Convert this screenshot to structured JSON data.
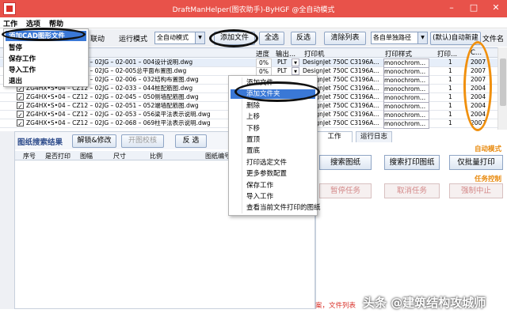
{
  "window": {
    "title": "DraftManHelper(图农助手)-ByHGF @全自动模式",
    "minimize": "–",
    "maximize": "□",
    "close": "✕"
  },
  "menubar": {
    "items": [
      "工作",
      "选项",
      "帮助"
    ]
  },
  "work_menu": {
    "items": [
      "添加CAD图形文件",
      "暂停",
      "保存工作",
      "导入工作",
      "退出"
    ],
    "highlighted_index": 0
  },
  "toolbar": {
    "linked_label": "联动",
    "run_mode_label": "运行模式",
    "run_mode_value": "全自动模式",
    "add_file": "添加文件",
    "select_all": "全选",
    "invert": "反选",
    "clear_list": "清除列表",
    "path_combo": "各自单独路径",
    "default_auto_new": "(默认)自动新建",
    "file_name_label": "文件名"
  },
  "grid": {
    "columns": [
      "进度",
      "输出...",
      "打印机",
      "打印样式",
      "打印...",
      "",
      "C..."
    ],
    "rows": [
      {
        "name": "ZG4HX•S•04 – CZ12 – 02JG – 02-001 – 004设计说明.dwg",
        "checked": true,
        "pct": "0%",
        "out": "PLT",
        "printer": "DesignJet  750C  C3196A...",
        "style": "monochrom...",
        "copies": "1",
        "year": "2007",
        "selected": true
      },
      {
        "name": "ZG4HX•S•04 – CZ12 – 02JG – 02-005总平面布置图.dwg",
        "checked": true,
        "pct": "0%",
        "out": "PLT",
        "printer": "DesignJet  750C  C3196A...",
        "style": "monochrom...",
        "copies": "1",
        "year": "2007",
        "selected": false
      },
      {
        "name": "ZG4HX•S•04 – CZ12 – 02JG – 02-006 – 032结构布置图.dwg",
        "checked": true,
        "pct": "0%",
        "out": "PLT",
        "printer": "DesignJet  750C  C3196A...",
        "style": "monochrom...",
        "copies": "1",
        "year": "2007",
        "selected": false
      },
      {
        "name": "ZG4HX•S•04 – CZ12 – 02JG – 02-033 – 044桩配筋图.dwg",
        "checked": true,
        "pct": "0%",
        "out": "PLT",
        "printer": "DesignJet  750C  C3196A...",
        "style": "monochrom...",
        "copies": "1",
        "year": "2004",
        "selected": false
      },
      {
        "name": "ZG4HX•S•04 – CZ12 – 02JG – 02-045 – 050侧墙配筋图.dwg",
        "checked": true,
        "pct": "0%",
        "out": "PLT",
        "printer": "DesignJet  750C  C3196A...",
        "style": "monochrom...",
        "copies": "1",
        "year": "2004",
        "selected": false
      },
      {
        "name": "ZG4HX•S•04 – CZ12 – 02JG – 02-051 – 052端墙配筋图.dwg",
        "checked": true,
        "pct": "0%",
        "out": "PLT",
        "printer": "DesignJet  750C  C3196A...",
        "style": "monochrom...",
        "copies": "1",
        "year": "2004",
        "selected": false
      },
      {
        "name": "ZG4HX•S•04 – CZ12 – 02JG – 02-053 – 056梁平法表示说明.dwg",
        "checked": true,
        "pct": "0%",
        "out": "PLT",
        "printer": "DesignJet  750C  C3196A...",
        "style": "monochrom...",
        "copies": "1",
        "year": "2004",
        "selected": false
      },
      {
        "name": "ZG4HX•S•04 – CZ12 – 02JG – 02-068 – 069柱平法表示说明.dwg",
        "checked": true,
        "pct": "0%",
        "out": "PLT",
        "printer": "DesignJet  750C  C3196A...",
        "style": "monochrom...",
        "copies": "1",
        "year": "2007",
        "selected": false
      }
    ]
  },
  "context_menu": {
    "items": [
      "添加文件",
      "添加文件夹",
      "删除",
      "上移",
      "下移",
      "置顶",
      "置底",
      "打印选定文件",
      "更多参数配置",
      "保存工作",
      "导入工作",
      "查看当前文件打印的图纸"
    ],
    "highlighted_index": 1
  },
  "search_panel": {
    "title": "图纸搜索结果",
    "unlock_edit": "解锁&修改",
    "open_check": "开图校核",
    "invert": "反 选",
    "columns": [
      "序号",
      "是否打印",
      "图幅",
      "尺寸",
      "比例",
      "图纸编号"
    ]
  },
  "right_panel": {
    "tabs": [
      "工作",
      "运行日志"
    ],
    "auto_mode_label": "自动模式",
    "search_drawings": "搜索图纸",
    "search_print": "搜索打印图纸",
    "batch_print_only": "仅批量打印",
    "task_control_label": "任务控制",
    "pause_task": "暂停任务",
    "cancel_task": "取消任务",
    "force_stop": "强制中止"
  },
  "status_text": "案，文件列表",
  "watermark": "头条 @建筑结构攻城师",
  "colors": {
    "titlebar": "#e8524a",
    "highlight": "#3a78d6",
    "section_label": "#e8890c",
    "annotation_orange": "#f0900e"
  }
}
